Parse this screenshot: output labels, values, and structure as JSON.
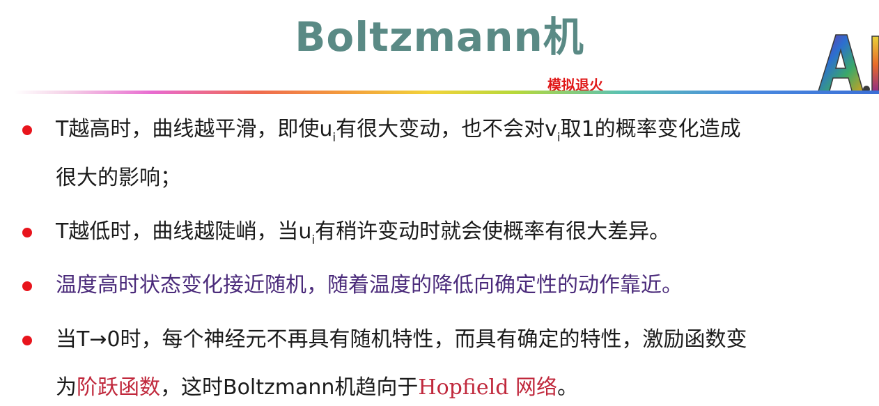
{
  "slide": {
    "title": "Boltzmann机",
    "subtitle": "模拟退火",
    "logo_text": "A.I"
  },
  "bullets": [
    {
      "lines": [
        {
          "p1": "T越高时，曲线越平滑，即使u",
          "sub1": "i",
          "p2": "有很大变动，也不会对v",
          "sub2": "i",
          "p3": "取1的概率变化造成"
        },
        {
          "text": "很大的影响；"
        }
      ]
    },
    {
      "p1": "T越低时，曲线越陡峭，当u",
      "sub1": "i",
      "p2": "有稍许变动时就会使概率有很大差异。"
    },
    {
      "text": "温度高时状态变化接近随机，随着温度的降低向确定性的动作靠近。"
    },
    {
      "line1": "当T→0时，每个神经元不再具有随机特性，而具有确定的特性，激励函数变",
      "line2_p1": "为",
      "line2_red1": "阶跃函数",
      "line2_p2": "，这时Boltzmann机趋向于",
      "line2_red2": "Hopfield 网络",
      "line2_p3": "。"
    }
  ],
  "colors": {
    "title": "#5a8a85",
    "subtitle": "#e01818",
    "bullet_dot": "#e8141c",
    "text": "#1b1b1b",
    "purple_text": "#4a2a7a",
    "highlight": "#c0283c"
  }
}
